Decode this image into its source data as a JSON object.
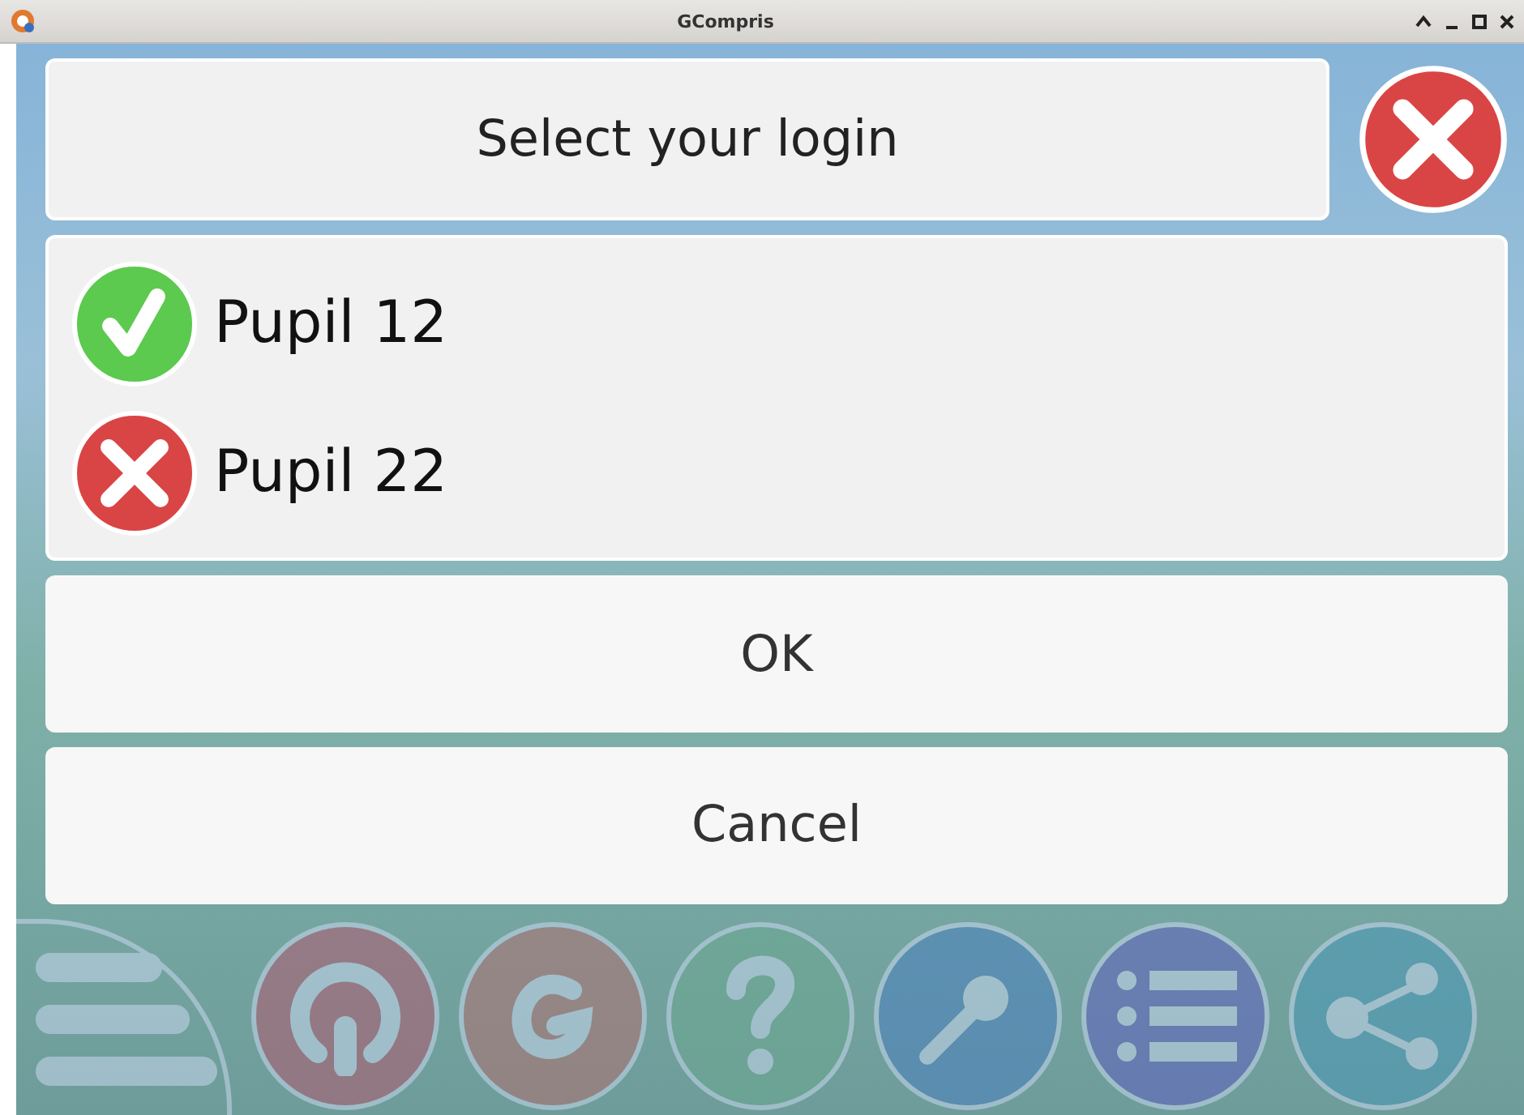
{
  "window": {
    "title": "GCompris"
  },
  "dialog": {
    "title": "Select your login",
    "users": [
      {
        "name": "Pupil 12",
        "selected": true
      },
      {
        "name": "Pupil 22",
        "selected": false
      }
    ],
    "buttons": [
      {
        "label": "OK"
      },
      {
        "label": "Cancel"
      }
    ]
  }
}
